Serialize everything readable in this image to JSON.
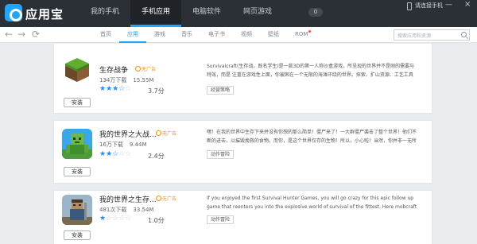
{
  "app": {
    "brand": "应用宝"
  },
  "topnav": [
    "我的手机",
    "手机应用",
    "电脑软件",
    "网页游戏"
  ],
  "topbar": {
    "download_count": "0",
    "connect_text": "请连接手机",
    "minimize": "—",
    "close": "×"
  },
  "subtabs": [
    "首页",
    "应用",
    "游戏",
    "音乐",
    "电子书",
    "视频",
    "壁纸",
    "ROM"
  ],
  "search": {
    "placeholder": "搜索应用和资源"
  },
  "nav": {
    "back": "←",
    "forward": "→",
    "refresh": "⟳"
  },
  "apps": [
    {
      "name": "生存战争",
      "ad": "无广告",
      "downloads": "134万下载",
      "size": "15.55M",
      "rating": 3.5,
      "score": "3.7分",
      "desc": "Survivalcraft(生存战，既名学生)是一款3D的第一人称沙盒游戏，所呈现的世界并不是刚的需要与",
      "desc2": "特效，而是 注重在游戏性上面，你被困在一个无限的海滩环绕的世界。探索、扩山资源、工艺工具",
      "tag": "经营策略",
      "install": "安装"
    },
    {
      "name": "我的世界之大战...",
      "ad": "无广告",
      "downloads": "16万下载",
      "size": "9.44M",
      "rating": 2.5,
      "score": "2.4分",
      "desc": "嘿！在我的世界中生存下来并没有你想的那么简单！僵尸来了！一大群僵尸袭击了整个世界！他们不",
      "desc2": "断的进击，以摧毁挽救的食物。而你，是这个世界仅存的生物！所以，小心啦！当然，你并非一无所",
      "tag": "动作冒险",
      "install": "安装"
    },
    {
      "name": "我的世界之生存...",
      "ad": "无广告",
      "downloads": "481次下载",
      "size": "33.54M",
      "rating": 1,
      "score": "1.0分",
      "desc": "If you enjoyed the first Survival Hunter Games, you will go crazy for this epic follow up",
      "desc2": "game that reenters you into the explosive world of survival of the fittest. Here mobcraft",
      "tag": "动作冒险",
      "install": "安装"
    }
  ],
  "colors": {
    "accent": "#20a5ff",
    "topbar": "#2b2f36",
    "ad": "#ff8a1f"
  },
  "icons": [
    "logo-icon",
    "back-icon",
    "forward-icon",
    "refresh-icon",
    "search-icon",
    "phone-icon",
    "minimize-icon",
    "close-icon"
  ]
}
